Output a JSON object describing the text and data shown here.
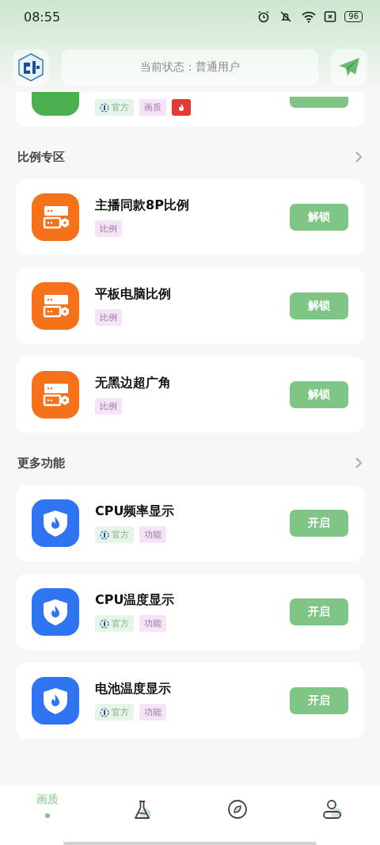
{
  "status_bar": {
    "time": "08:55",
    "battery": "96"
  },
  "header": {
    "status_text": "当前状态：普通用户"
  },
  "partial_card": {
    "tags": [
      {
        "kind": "official",
        "label": "官方"
      },
      {
        "kind": "category",
        "label": "画质"
      },
      {
        "kind": "hot"
      }
    ]
  },
  "sections": [
    {
      "title": "比例专区",
      "items": [
        {
          "title": "主播同款8P比例",
          "kind": "device",
          "tags": [
            {
              "kind": "category",
              "label": "比例"
            }
          ],
          "button": "解锁"
        },
        {
          "title": "平板电脑比例",
          "kind": "device",
          "tags": [
            {
              "kind": "category",
              "label": "比例"
            }
          ],
          "button": "解锁"
        },
        {
          "title": "无黑边超广角",
          "kind": "device",
          "tags": [
            {
              "kind": "category",
              "label": "比例"
            }
          ],
          "button": "解锁"
        }
      ]
    },
    {
      "title": "更多功能",
      "items": [
        {
          "title": "CPU频率显示",
          "kind": "shield",
          "tags": [
            {
              "kind": "official",
              "label": "官方"
            },
            {
              "kind": "category",
              "label": "功能"
            }
          ],
          "button": "开启"
        },
        {
          "title": "CPU温度显示",
          "kind": "shield",
          "tags": [
            {
              "kind": "official",
              "label": "官方"
            },
            {
              "kind": "category",
              "label": "功能"
            }
          ],
          "button": "开启"
        },
        {
          "title": "电池温度显示",
          "kind": "shield",
          "tags": [
            {
              "kind": "official",
              "label": "官方"
            },
            {
              "kind": "category",
              "label": "功能"
            }
          ],
          "button": "开启"
        }
      ]
    }
  ],
  "bottom_nav": [
    {
      "label": "画质",
      "selected": true
    },
    {
      "selected": false
    },
    {
      "selected": false
    },
    {
      "selected": false
    }
  ]
}
